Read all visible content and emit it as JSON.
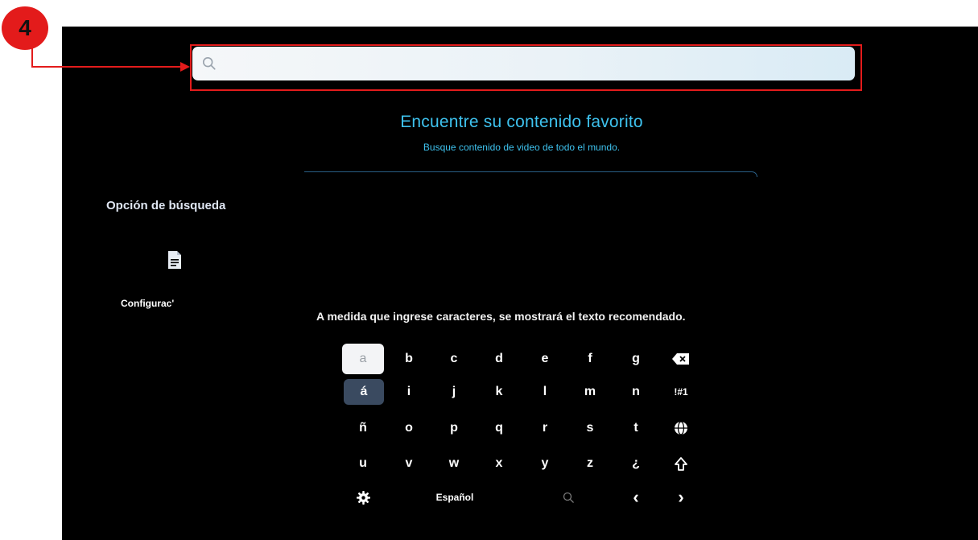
{
  "annotation": {
    "step_number": "4",
    "color": "#e31b1b"
  },
  "search": {
    "placeholder": ""
  },
  "header": {
    "title": "Encuentre su contenido favorito",
    "subtitle": "Busque contenido de video de todo el mundo."
  },
  "sidebar": {
    "search_option_title": "Opción de búsqueda",
    "settings_label": "Configurac'",
    "doc_icon": "document-icon"
  },
  "hint": "A medida que ingrese caracteres, se mostrará el texto recomendado.",
  "keyboard": {
    "rows": [
      [
        "a",
        "b",
        "c",
        "d",
        "e",
        "f",
        "g"
      ],
      [
        "á",
        "i",
        "j",
        "k",
        "l",
        "m",
        "n"
      ],
      [
        "ñ",
        "o",
        "p",
        "q",
        "r",
        "s",
        "t"
      ],
      [
        "u",
        "v",
        "w",
        "x",
        "y",
        "z",
        "¿"
      ]
    ],
    "side_keys": {
      "backspace": "backspace-icon",
      "symbols": "!#1",
      "globe": "globe-icon",
      "shift": "shift-icon"
    },
    "bottom": {
      "language": "Español",
      "settings": "gear-icon",
      "search": "search-icon",
      "left": "‹",
      "right": "›"
    }
  },
  "colors": {
    "accent": "#3ec2ee",
    "background": "#000000",
    "focused_key": "#f3f4f6",
    "alt_key": "#3a4a60"
  }
}
